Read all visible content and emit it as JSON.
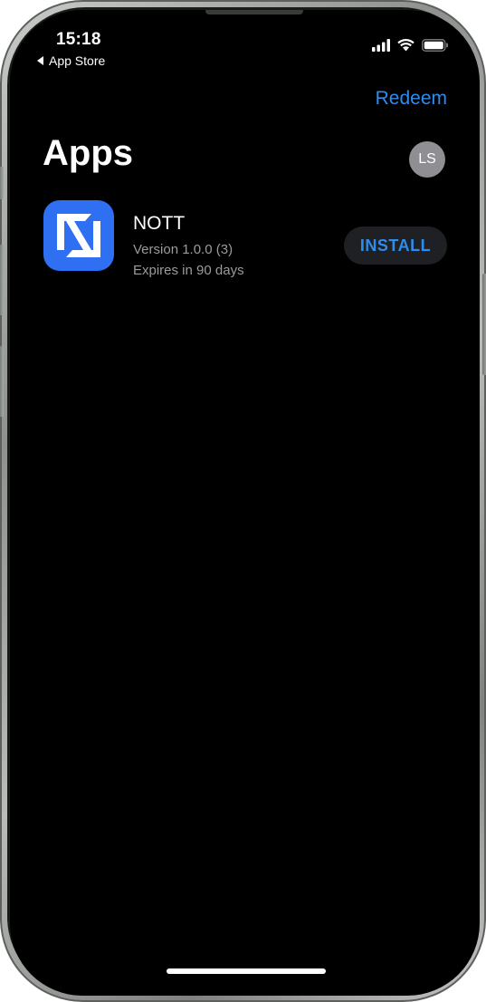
{
  "status_bar": {
    "time": "15:18",
    "back_label": "App Store"
  },
  "header": {
    "redeem_label": "Redeem",
    "title": "Apps",
    "avatar_initials": "LS"
  },
  "apps": [
    {
      "name": "NOTT",
      "version": "Version 1.0.0 (3)",
      "expiry": "Expires in 90 days",
      "action_label": "INSTALL",
      "icon": "nott-logo-icon"
    }
  ],
  "colors": {
    "accent": "#2d8cf0",
    "background": "#000000",
    "app_icon_bg": "#2f6ff2",
    "secondary_text": "#9b9b9f",
    "button_bg": "#1f2023"
  }
}
